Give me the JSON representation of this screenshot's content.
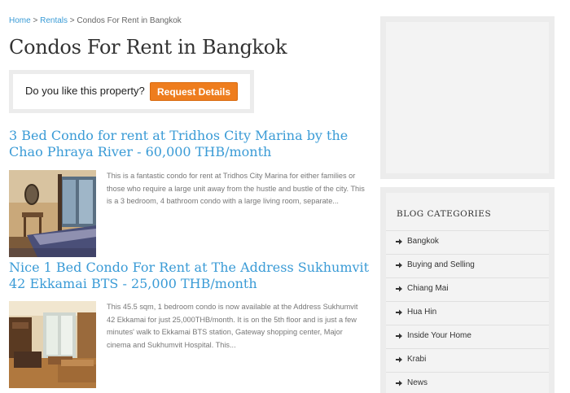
{
  "breadcrumb": {
    "home": "Home",
    "sep1": ">",
    "rentals": "Rentals",
    "sep2": ">",
    "current": "Condos For Rent in Bangkok"
  },
  "page_title": "Condos For Rent in Bangkok",
  "cta": {
    "question": "Do you like this property?",
    "button": "Request Details"
  },
  "listings": [
    {
      "title": "3 Bed Condo for rent at Tridhos City Marina by the Chao Phraya River - 60,000 THB/month",
      "excerpt": "This is a fantastic condo for rent at Tridhos City Marina for either families or those who require a large unit away from the hustle and bustle of the city. This is a 3 bedroom, 4 bathroom condo with a large living room, separate..."
    },
    {
      "title": "Nice 1 Bed Condo For Rent at The Address Sukhumvit 42 Ekkamai BTS - 25,000 THB/month",
      "excerpt": "This 45.5 sqm, 1 bedroom condo is now available at the Address Sukhumvit 42 Ekkamai for just 25,000THB/month. It is on the 5th floor and is just a few minutes' walk to Ekkamai BTS station, Gateway shopping center, Major cinema and Sukhumvit Hospital. This..."
    }
  ],
  "sidebar": {
    "categories_title": "BLOG CATEGORIES",
    "categories": [
      {
        "label": "Bangkok"
      },
      {
        "label": "Buying and Selling"
      },
      {
        "label": "Chiang Mai"
      },
      {
        "label": "Hua Hin"
      },
      {
        "label": "Inside Your Home"
      },
      {
        "label": "Krabi"
      },
      {
        "label": "News"
      }
    ]
  },
  "colors": {
    "link": "#3a9bd6",
    "button": "#ee7d1e",
    "title": "#333333",
    "box_bg": "#ececec"
  }
}
